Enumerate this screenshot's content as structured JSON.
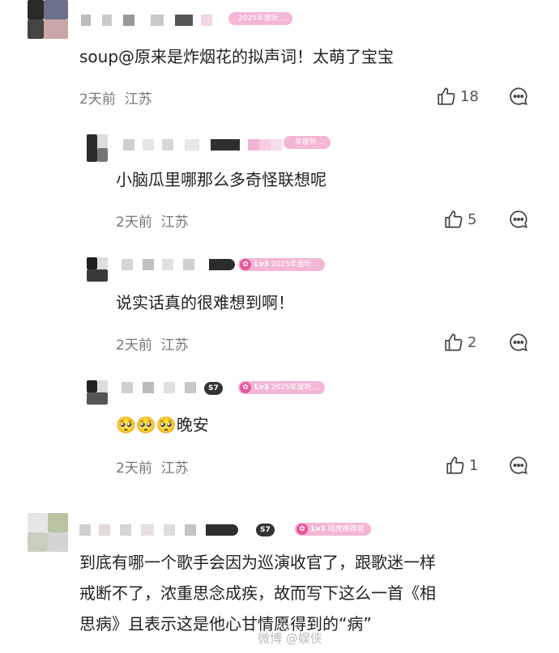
{
  "comments": [
    {
      "badge": "2025年度听...",
      "text": "soup@原来是炸烟花的拟声词！太萌了宝宝",
      "time": "2天前",
      "location": "江苏",
      "likes": "18"
    },
    {
      "badge": "年度听...",
      "text": "小脑瓜里哪那么多奇怪联想呢",
      "time": "2天前",
      "location": "江苏",
      "likes": "5"
    },
    {
      "badge_level": "Lv3",
      "badge": "2025年度听...",
      "text": "说实话真的很难想到啊！",
      "time": "2天前",
      "location": "江苏",
      "likes": "2"
    },
    {
      "level_tag": "S7",
      "badge_level": "Lv3",
      "badge": "2025年度听...",
      "text": "🥺🥺🥺晚安",
      "time": "2天前",
      "location": "江苏",
      "likes": "1"
    },
    {
      "level_tag": "S7",
      "badge_level": "Lv1",
      "badge": "陆虎推荐官",
      "text_lines": [
        "到底有哪一个歌手会因为巡演收官了，跟歌迷一样",
        "戒断不了，浓重思念成疾，故而写下这么一首《相",
        "思病》且表示这是他心甘情愿得到的“病”"
      ]
    }
  ],
  "watermark": "微博 @娱侠",
  "colors": {
    "badge_pink": "#f3b6d4",
    "badge_icon": "#e8579c",
    "meta_gray": "#777777"
  },
  "icons": {
    "like": "thumbs-up-icon",
    "comment": "comment-bubble-icon"
  }
}
